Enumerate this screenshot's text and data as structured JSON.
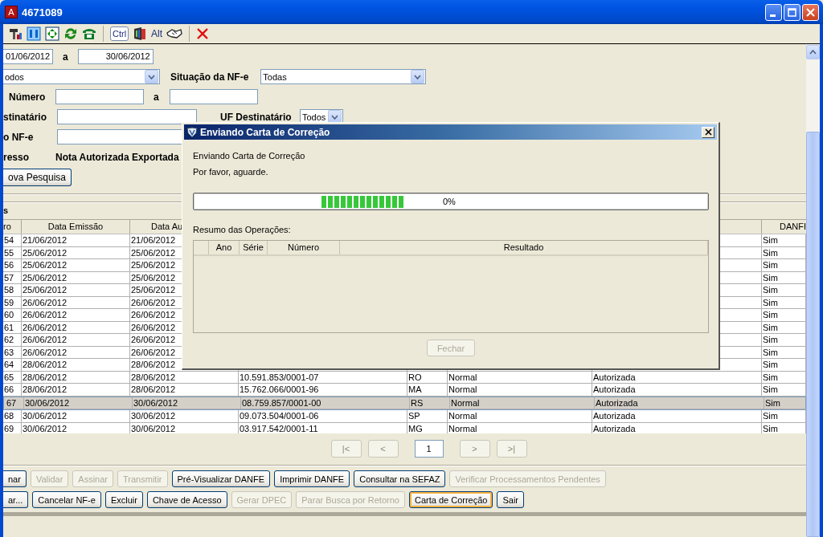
{
  "window": {
    "icon_letter": "A",
    "title": "4671089"
  },
  "toolbar": {
    "ctrl_label": "Ctrl",
    "alt_label": "Alt"
  },
  "filters": {
    "date_from": "01/06/2012",
    "date_sep": "a",
    "date_to": "30/06/2012",
    "type_select": "odos",
    "situacao_label": "Situação da NF-e",
    "situacao_select": "Todas",
    "numero_label": "Número",
    "numero_sep": "a",
    "destinatario_label": "stinatário",
    "uf_label": "UF Destinatário",
    "uf_select": "Todos",
    "nfe_label": "o NF-e",
    "ingresso_label": "resso",
    "ingresso_value": "Nota Autorizada Exportada",
    "search_button": "ova Pesquisa"
  },
  "section_title": "s",
  "table": {
    "columns": [
      "ro",
      "Data Emissão",
      "Data Au",
      "DANFI"
    ],
    "rows": [
      {
        "cells": [
          "54",
          "21/06/2012",
          "21/06/2012",
          "Sim"
        ],
        "selected": false
      },
      {
        "cells": [
          "55",
          "25/06/2012",
          "25/06/2012",
          "Sim"
        ],
        "selected": false
      },
      {
        "cells": [
          "56",
          "25/06/2012",
          "25/06/2012",
          "Sim"
        ],
        "selected": false
      },
      {
        "cells": [
          "57",
          "25/06/2012",
          "25/06/2012",
          "Sim"
        ],
        "selected": false
      },
      {
        "cells": [
          "58",
          "25/06/2012",
          "25/06/2012",
          "Sim"
        ],
        "selected": false
      },
      {
        "cells": [
          "59",
          "26/06/2012",
          "26/06/2012",
          "Sim"
        ],
        "selected": false
      },
      {
        "cells": [
          "60",
          "26/06/2012",
          "26/06/2012",
          "Sim"
        ],
        "selected": false
      },
      {
        "cells": [
          "61",
          "26/06/2012",
          "26/06/2012",
          "Sim"
        ],
        "selected": false
      },
      {
        "cells": [
          "62",
          "26/06/2012",
          "26/06/2012",
          "Sim"
        ],
        "selected": false
      },
      {
        "cells": [
          "63",
          "26/06/2012",
          "26/06/2012",
          "Sim"
        ],
        "selected": false
      },
      {
        "cells": [
          "64",
          "28/06/2012",
          "28/06/2012",
          "Sim"
        ],
        "selected": false
      },
      {
        "cells": [
          "65",
          "28/06/2012",
          "28/06/2012",
          "10.591.853/0001-07",
          "RO",
          "Normal",
          "Autorizada",
          "Sim"
        ],
        "selected": false
      },
      {
        "cells": [
          "66",
          "28/06/2012",
          "28/06/2012",
          "15.762.066/0001-96",
          "MA",
          "Normal",
          "Autorizada",
          "Sim"
        ],
        "selected": false
      },
      {
        "cells": [
          "67",
          "30/06/2012",
          "30/06/2012",
          "08.759.857/0001-00",
          "RS",
          "Normal",
          "Autorizada",
          "Sim"
        ],
        "selected": true
      },
      {
        "cells": [
          "68",
          "30/06/2012",
          "30/06/2012",
          "09.073.504/0001-06",
          "SP",
          "Normal",
          "Autorizada",
          "Sim"
        ],
        "selected": false
      },
      {
        "cells": [
          "69",
          "30/06/2012",
          "30/06/2012",
          "03.917.542/0001-11",
          "MG",
          "Normal",
          "Autorizada",
          "Sim"
        ],
        "selected": false
      }
    ]
  },
  "pagination": {
    "first": {
      "label": "|<",
      "disabled": true
    },
    "prev": {
      "label": "<",
      "disabled": true
    },
    "page": "1",
    "next": {
      "label": ">",
      "disabled": true
    },
    "last": {
      "label": ">|",
      "disabled": true
    }
  },
  "button_rows": [
    [
      {
        "label": "nar",
        "disabled": false,
        "focused": false
      },
      {
        "label": "Validar",
        "disabled": true,
        "focused": false
      },
      {
        "label": "Assinar",
        "disabled": true,
        "focused": false
      },
      {
        "label": "Transmitir",
        "disabled": true,
        "focused": false
      },
      {
        "label": "Pré-Visualizar DANFE",
        "disabled": false,
        "focused": false
      },
      {
        "label": "Imprimir DANFE",
        "disabled": false,
        "focused": false
      },
      {
        "label": "Consultar na SEFAZ",
        "disabled": false,
        "focused": false
      },
      {
        "label": "Verificar Processamentos Pendentes",
        "disabled": true,
        "focused": false
      }
    ],
    [
      {
        "label": "ar...",
        "disabled": false,
        "focused": false
      },
      {
        "label": "Cancelar NF-e",
        "disabled": false,
        "focused": false
      },
      {
        "label": "Excluir",
        "disabled": false,
        "focused": false
      },
      {
        "label": "Chave de Acesso",
        "disabled": false,
        "focused": false
      },
      {
        "label": "Gerar DPEC",
        "disabled": true,
        "focused": false
      },
      {
        "label": "Parar Busca por Retorno",
        "disabled": true,
        "focused": false
      },
      {
        "label": "Carta de Correção",
        "disabled": false,
        "focused": true
      },
      {
        "label": "Sair",
        "disabled": false,
        "focused": false
      }
    ]
  ],
  "dialog": {
    "title": "Enviando Carta de Correção",
    "message": "Enviando Carta de Correção",
    "wait": "Por favor, aguarde.",
    "progress": {
      "level": 0,
      "indeterminate": true,
      "reading": "0%"
    },
    "summary_label": "Resumo das Operações:",
    "summary_columns": [
      "Ano",
      "Série",
      "Número",
      "Resultado"
    ],
    "close_button": {
      "label": "Fechar",
      "disabled": true
    }
  }
}
